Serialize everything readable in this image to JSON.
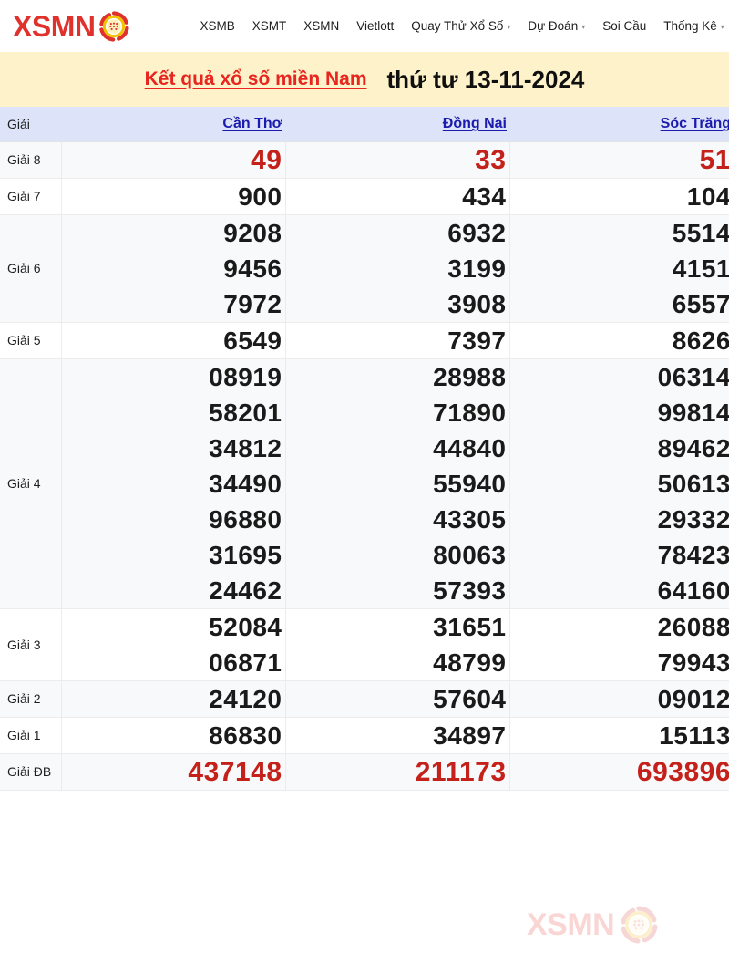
{
  "header": {
    "brand": "XSMN",
    "brand_icon": "lottery-ball-emblem-icon",
    "brand_color": "#e0322c",
    "nav": [
      {
        "label": "XSMB",
        "has_caret": false
      },
      {
        "label": "XSMT",
        "has_caret": false
      },
      {
        "label": "XSMN",
        "has_caret": false
      },
      {
        "label": "Vietlott",
        "has_caret": false
      },
      {
        "label": "Quay Thử Xổ Số",
        "has_caret": true
      },
      {
        "label": "Dự Đoán",
        "has_caret": true
      },
      {
        "label": "Soi Cầu",
        "has_caret": false
      },
      {
        "label": "Thống Kê",
        "has_caret": true
      }
    ],
    "caret_glyph": "▾"
  },
  "title_bar": {
    "background": "#fdf2c9",
    "heading": "Kết quả xổ số miền Nam",
    "heading_color": "#e8251f",
    "date": "thứ tư 13-11-2024",
    "date_color": "#101010"
  },
  "table": {
    "header_background": "#dde3f8",
    "label_column_header": "Giải",
    "provinces": [
      "Cần Thơ",
      "Đồng Nai",
      "Sóc Trăng"
    ],
    "province_link_color": "#1b1bad",
    "highlight_color": "#c4211b",
    "rows": [
      {
        "label": "Giải 8",
        "style": "highlight",
        "values": [
          [
            "49"
          ],
          [
            "33"
          ],
          [
            "51"
          ]
        ]
      },
      {
        "label": "Giải 7",
        "style": "normal",
        "values": [
          [
            "900"
          ],
          [
            "434"
          ],
          [
            "104"
          ]
        ]
      },
      {
        "label": "Giải 6",
        "style": "normal",
        "values": [
          [
            "9208",
            "9456",
            "7972"
          ],
          [
            "6932",
            "3199",
            "3908"
          ],
          [
            "5514",
            "4151",
            "6557"
          ]
        ]
      },
      {
        "label": "Giải 5",
        "style": "normal",
        "values": [
          [
            "6549"
          ],
          [
            "7397"
          ],
          [
            "8626"
          ]
        ]
      },
      {
        "label": "Giải 4",
        "style": "normal",
        "values": [
          [
            "08919",
            "58201",
            "34812",
            "34490",
            "96880",
            "31695",
            "24462"
          ],
          [
            "28988",
            "71890",
            "44840",
            "55940",
            "43305",
            "80063",
            "57393"
          ],
          [
            "06314",
            "99814",
            "89462",
            "50613",
            "29332",
            "78423",
            "64160"
          ]
        ]
      },
      {
        "label": "Giải 3",
        "style": "normal",
        "values": [
          [
            "52084",
            "06871"
          ],
          [
            "31651",
            "48799"
          ],
          [
            "26088",
            "79943"
          ]
        ]
      },
      {
        "label": "Giải 2",
        "style": "normal",
        "values": [
          [
            "24120"
          ],
          [
            "57604"
          ],
          [
            "09012"
          ]
        ]
      },
      {
        "label": "Giải 1",
        "style": "normal",
        "values": [
          [
            "86830"
          ],
          [
            "34897"
          ],
          [
            "15113"
          ]
        ]
      },
      {
        "label": "Giải ĐB",
        "style": "highlight",
        "values": [
          [
            "437148"
          ],
          [
            "211173"
          ],
          [
            "693896"
          ]
        ]
      }
    ]
  },
  "watermark": {
    "text": "XSMN",
    "icon": "lottery-ball-emblem-icon"
  }
}
